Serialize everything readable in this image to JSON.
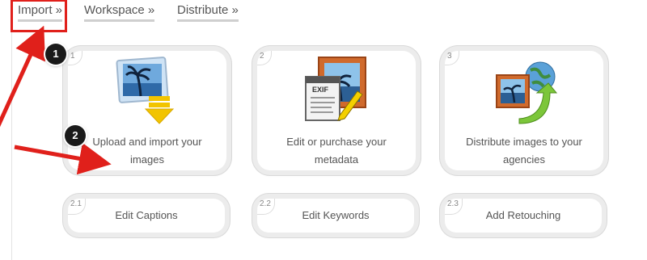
{
  "nav": {
    "items": [
      {
        "label": "Import »"
      },
      {
        "label": "Workspace »"
      },
      {
        "label": "Distribute »"
      }
    ]
  },
  "steps": [
    {
      "tag": "1",
      "label": "Upload and import your images",
      "icon": "upload-images-icon"
    },
    {
      "tag": "2",
      "label": "Edit or purchase your metadata",
      "icon": "edit-metadata-icon"
    },
    {
      "tag": "3",
      "label": "Distribute images to your agencies",
      "icon": "distribute-images-icon"
    }
  ],
  "substeps": [
    {
      "tag": "2.1",
      "label": "Edit Captions"
    },
    {
      "tag": "2.2",
      "label": "Edit Keywords"
    },
    {
      "tag": "2.3",
      "label": "Add Retouching"
    }
  ],
  "annotations": {
    "badge1": "1",
    "badge2": "2",
    "highlight_color": "#e0201b"
  }
}
